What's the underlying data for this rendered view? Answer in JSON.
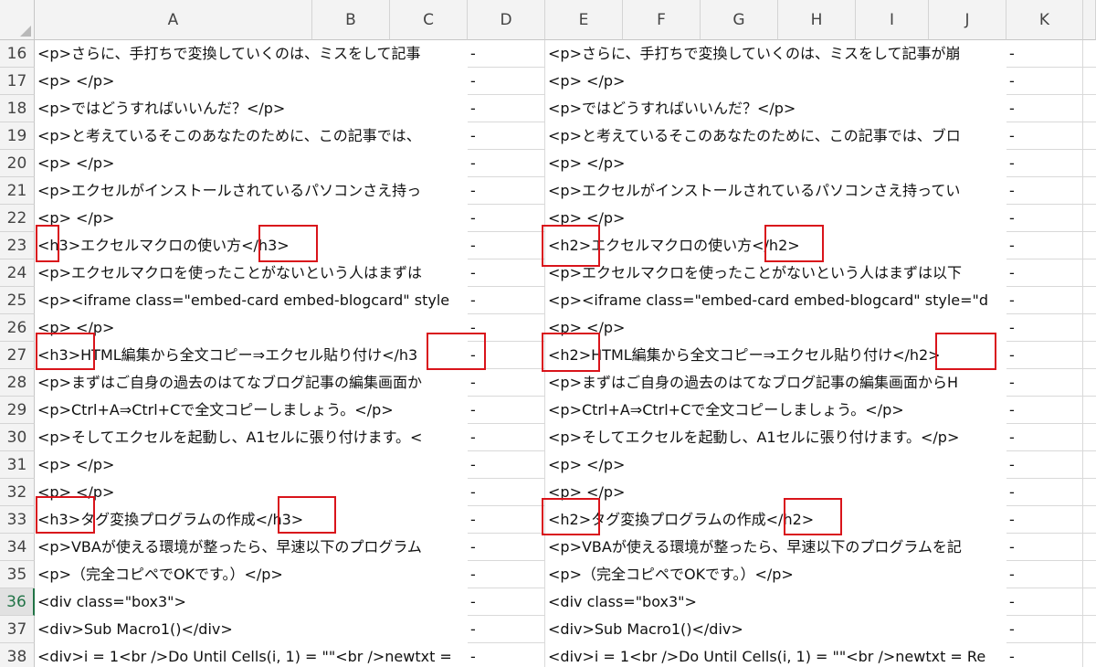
{
  "spreadsheet": {
    "columns": [
      "A",
      "B",
      "C",
      "D",
      "E",
      "F",
      "G",
      "H",
      "I",
      "J",
      "K"
    ],
    "active_row": "36",
    "highlight_color": "#d9141b",
    "rows": [
      {
        "num": "16",
        "a": "<p>さらに、手打ちで変換していくのは、ミスをして記事",
        "d": "-",
        "e": "<p>さらに、手打ちで変換していくのは、ミスをして記事が崩",
        "k": "-"
      },
      {
        "num": "17",
        "a": "<p> </p>",
        "d": "-",
        "e": "<p> </p>",
        "k": "-"
      },
      {
        "num": "18",
        "a": "<p>ではどうすればいいんだ？</p>",
        "d": "-",
        "e": "<p>ではどうすればいいんだ？</p>",
        "k": "-"
      },
      {
        "num": "19",
        "a": "<p>と考えているそこのあなたのために、この記事では、",
        "d": "-",
        "e": "<p>と考えているそこのあなたのために、この記事では、ブロ",
        "k": "-"
      },
      {
        "num": "20",
        "a": "<p> </p>",
        "d": "-",
        "e": "<p> </p>",
        "k": "-"
      },
      {
        "num": "21",
        "a": "<p>エクセルがインストールされているパソコンさえ持っ",
        "d": "-",
        "e": "<p>エクセルがインストールされているパソコンさえ持ってい",
        "k": "-"
      },
      {
        "num": "22",
        "a": "<p> </p>",
        "d": "-",
        "e": "<p> </p>",
        "k": "-"
      },
      {
        "num": "23",
        "a": "<h3>エクセルマクロの使い方</h3>",
        "d": "-",
        "e": "<h2>エクセルマクロの使い方</h2>",
        "k": "-"
      },
      {
        "num": "24",
        "a": "<p>エクセルマクロを使ったことがないという人はまずは",
        "d": "-",
        "e": "<p>エクセルマクロを使ったことがないという人はまずは以下",
        "k": "-"
      },
      {
        "num": "25",
        "a": "<p><iframe class=\"embed-card embed-blogcard\" style",
        "d": "-",
        "e": "<p><iframe class=\"embed-card embed-blogcard\" style=\"d",
        "k": "-"
      },
      {
        "num": "26",
        "a": "<p> </p>",
        "d": "-",
        "e": "<p> </p>",
        "k": "-"
      },
      {
        "num": "27",
        "a": "<h3>HTML編集から全文コピー⇒エクセル貼り付け</h3",
        "d": "-",
        "e": "<h2>HTML編集から全文コピー⇒エクセル貼り付け</h2>",
        "k": "-"
      },
      {
        "num": "28",
        "a": "<p>まずはご自身の過去のはてなブログ記事の編集画面か",
        "d": "-",
        "e": "<p>まずはご自身の過去のはてなブログ記事の編集画面からH",
        "k": "-"
      },
      {
        "num": "29",
        "a": "<p>Ctrl+A⇒Ctrl+Cで全文コピーしましょう。</p>",
        "d": "-",
        "e": "<p>Ctrl+A⇒Ctrl+Cで全文コピーしましょう。</p>",
        "k": "-"
      },
      {
        "num": "30",
        "a": "<p>そしてエクセルを起動し、A1セルに張り付けます。<",
        "d": "-",
        "e": "<p>そしてエクセルを起動し、A1セルに張り付けます。</p>",
        "k": "-"
      },
      {
        "num": "31",
        "a": "<p> </p>",
        "d": "-",
        "e": "<p> </p>",
        "k": "-"
      },
      {
        "num": "32",
        "a": "<p> </p>",
        "d": "-",
        "e": "<p> </p>",
        "k": "-"
      },
      {
        "num": "33",
        "a": "<h3>タグ変換プログラムの作成</h3>",
        "d": "-",
        "e": "<h2>タグ変換プログラムの作成</h2>",
        "k": "-"
      },
      {
        "num": "34",
        "a": "<p>VBAが使える環境が整ったら、早速以下のプログラム",
        "d": "-",
        "e": "<p>VBAが使える環境が整ったら、早速以下のプログラムを記",
        "k": "-"
      },
      {
        "num": "35",
        "a": "<p>（完全コピペでOKです。）</p>",
        "d": "-",
        "e": "<p>（完全コピペでOKです。）</p>",
        "k": "-"
      },
      {
        "num": "36",
        "a": "<div class=\"box3\">",
        "d": "-",
        "e": "<div class=\"box3\">",
        "k": "-"
      },
      {
        "num": "37",
        "a": "<div>Sub Macro1()</div>",
        "d": "-",
        "e": "<div>Sub Macro1()</div>",
        "k": "-"
      },
      {
        "num": "38",
        "a": "<div>i = 1<br />Do Until Cells(i, 1) = \"\"<br />newtxt =",
        "d": "-",
        "e": "<div>i = 1<br />Do Until Cells(i, 1) = \"\"<br />newtxt = Re",
        "k": "-"
      }
    ]
  }
}
